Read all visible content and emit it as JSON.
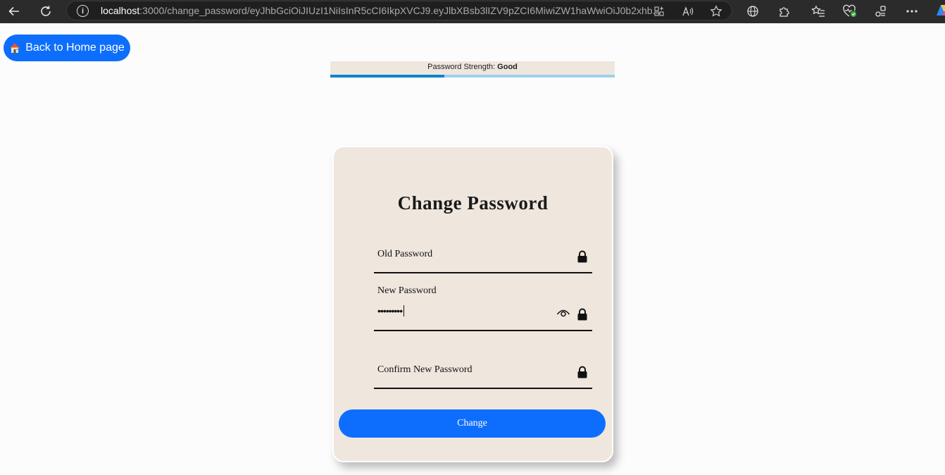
{
  "browser": {
    "url_host": "localhost",
    "url_rest": ":3000/change_password/eyJhbGciOiJIUzI1NiIsInR5cCI6IkpXVCJ9.eyJlbXBsb3lIZV9pZCI6MiwiZW1haWwiOiJ0b2xhb...",
    "info_glyph": "i"
  },
  "page": {
    "home_button_label": "Back to Home page",
    "strength": {
      "label": "Password Strength:",
      "value": "Good",
      "level_fraction": 0.4,
      "fill_color": "#0d86c8",
      "track_color": "#9fd0ee"
    },
    "form": {
      "title": "Change Password",
      "old_password_label": "Old Password",
      "new_password_label": "New Password",
      "new_password_value": "•••••••••",
      "confirm_password_label": "Confirm New Password",
      "submit_label": "Change"
    }
  },
  "colors": {
    "accent": "#0d6efd",
    "card_bg": "#efe6de",
    "page_bg": "#fcfcfc"
  }
}
